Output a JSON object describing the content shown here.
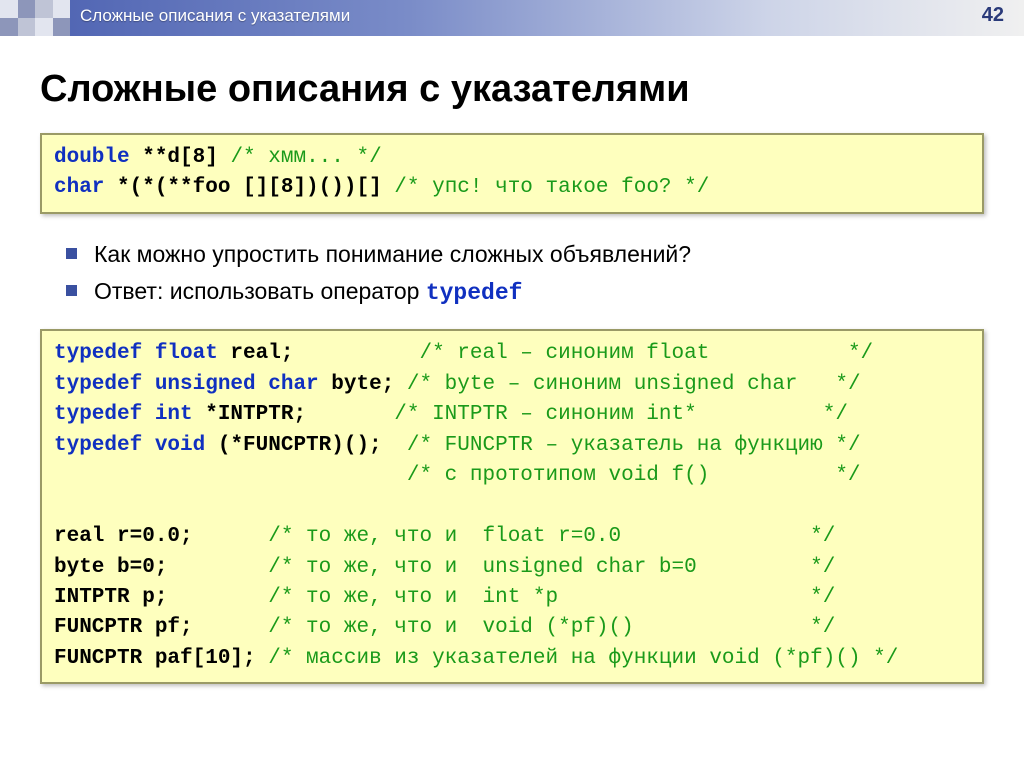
{
  "header": {
    "breadcrumb": "Сложные описания с указателями",
    "page_number": "42"
  },
  "title": "Сложные описания с указателями",
  "codebox1": {
    "l1_kw1": "double",
    "l1_rest": " **d[8] ",
    "l1_cmt": "/* хмм... */",
    "l2_kw1": "char",
    "l2_rest": " *(*(**foo [][8])())[] ",
    "l2_cmt": "/* упс! что такое foo? */"
  },
  "bullets": {
    "b1": "Как можно упростить понимание сложных объявлений?",
    "b2_prefix": "Ответ: использовать оператор ",
    "b2_kw": "typedef"
  },
  "codebox2": {
    "l1": {
      "kw": "typedef float",
      "id": " real;          ",
      "cmt": "/* real – синоним float           */"
    },
    "l2": {
      "kw": "typedef unsigned char",
      "id": " byte; ",
      "cmt": "/* byte – синоним unsigned char   */"
    },
    "l3": {
      "kw": "typedef int",
      "id": " *INTPTR;       ",
      "cmt": "/* INTPTR – синоним int*          */"
    },
    "l4": {
      "kw": "typedef void",
      "id": " (*FUNCPTR)();  ",
      "cmt": "/* FUNCPTR – указатель на функцию */"
    },
    "l5": {
      "pad": "                            ",
      "cmt": "/* с прототипом void f()          */"
    },
    "blank": "",
    "l6": {
      "id": "real r=0.0;      ",
      "cmt": "/* то же, что и  float r=0.0               */"
    },
    "l7": {
      "id": "byte b=0;        ",
      "cmt": "/* то же, что и  unsigned char b=0         */"
    },
    "l8": {
      "id": "INTPTR p;        ",
      "cmt": "/* то же, что и  int *p                    */"
    },
    "l9": {
      "id": "FUNCPTR pf;      ",
      "cmt": "/* то же, что и  void (*pf)()              */"
    },
    "l10": {
      "id": "FUNCPTR paf[10]; ",
      "cmt": "/* массив из указателей на функции void (*pf)() */"
    }
  }
}
